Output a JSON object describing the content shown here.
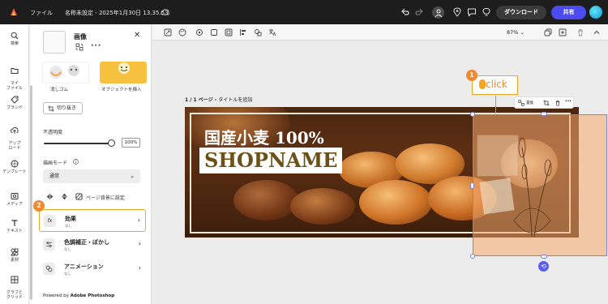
{
  "topbar": {
    "file_menu": "ファイル",
    "doc_title": "名称未設定 - 2025年1月30日 13.35.53",
    "download_label": "ダウンロード",
    "share_label": "共有"
  },
  "rail": {
    "items": [
      {
        "label": "検索",
        "icon": "search-icon"
      },
      {
        "label": "マイ\nファイル",
        "icon": "folder-icon"
      },
      {
        "label": "ブランド",
        "icon": "brand-icon"
      },
      {
        "label": "アップ\nロード",
        "icon": "upload-icon"
      },
      {
        "label": "テンプレート",
        "icon": "template-icon"
      },
      {
        "label": "メディア",
        "icon": "media-icon"
      },
      {
        "label": "テキスト",
        "icon": "text-icon"
      },
      {
        "label": "素材",
        "icon": "elements-icon"
      },
      {
        "label": "グラフと\nグリッド",
        "icon": "grid-icon"
      }
    ]
  },
  "panel": {
    "title": "画像",
    "tiles": [
      {
        "label": "消しゴム"
      },
      {
        "label": "オブジェクトを挿入"
      }
    ],
    "crop_label": "切り抜き",
    "opacity_label": "不透明度",
    "opacity_value": "100%",
    "opacity_fraction": 1.0,
    "blend_label": "描画モード",
    "blend_value": "通常",
    "bg_label": "ページ背景に設定",
    "list": [
      {
        "title": "効果",
        "sub": "なし",
        "icon_text": "fx"
      },
      {
        "title": "色調補正・ぼかし",
        "sub": "なし",
        "icon_text": ""
      },
      {
        "title": "アニメーション",
        "sub": "なし",
        "icon_text": ""
      }
    ],
    "footer_prefix": "Powered by ",
    "footer_brand": "Adobe Photoshop"
  },
  "canvas": {
    "zoom": "87%",
    "page_label_prefix": "1 / 1 ページ - ",
    "page_label_action": "タイトルを追加",
    "headline1": "国産小麦 100%",
    "headline2": "SHOPNAME",
    "ctx_replace": "置換"
  },
  "annotations": {
    "click_label": "click",
    "badge1": "1",
    "badge2": "2"
  },
  "colors": {
    "accent": "#f5a524",
    "share": "#4b4bef",
    "topbar": "#1d1d1d"
  }
}
